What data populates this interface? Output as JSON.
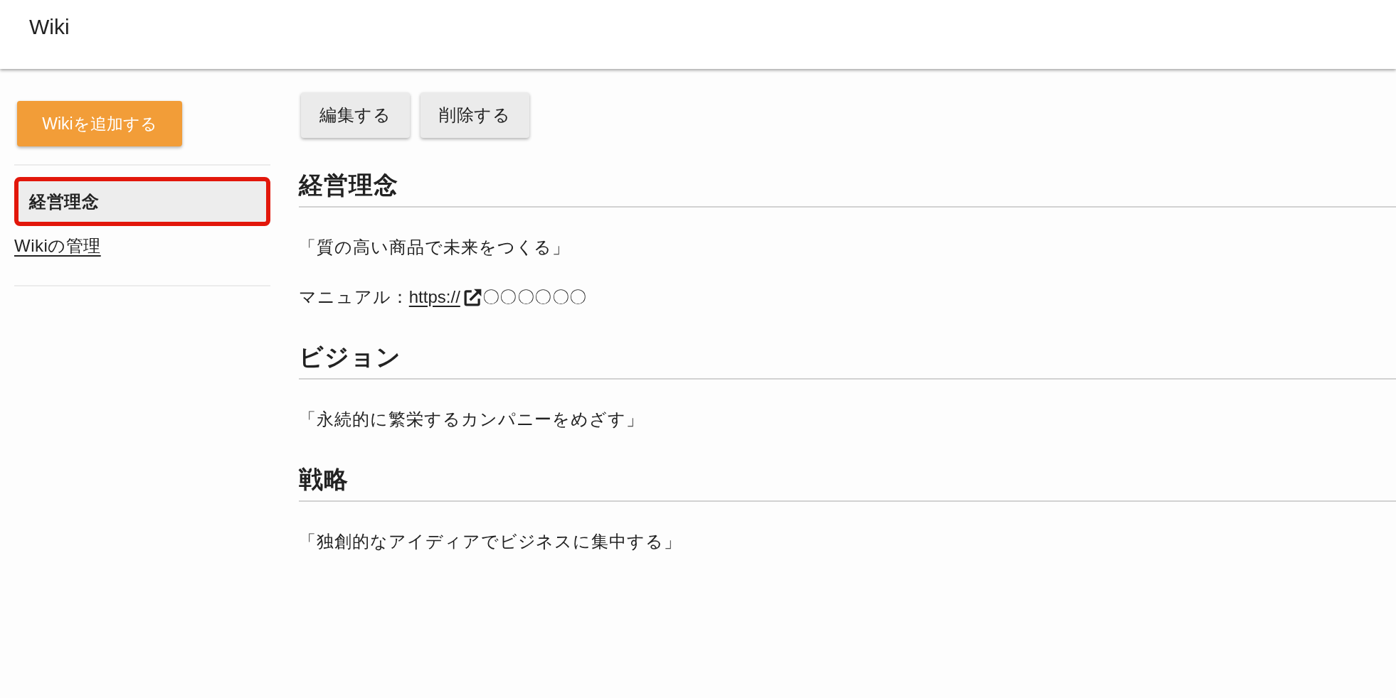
{
  "header": {
    "title": "Wiki"
  },
  "sidebar": {
    "add_button": "Wikiを追加する",
    "items": [
      {
        "label": "経営理念",
        "selected": true
      }
    ],
    "manage_link": "Wikiの管理"
  },
  "actions": [
    "編集する",
    "削除する"
  ],
  "sections": [
    {
      "heading": "経営理念",
      "paragraphs": [
        {
          "kind": "text",
          "text": "「質の高い商品で未来をつくる」"
        },
        {
          "kind": "link",
          "label": "マニュアル：",
          "link": "https://",
          "after": "〇〇〇〇〇〇"
        }
      ]
    },
    {
      "heading": "ビジョン",
      "paragraphs": [
        {
          "kind": "text",
          "text": "「永続的に繁栄するカンパニーをめざす」"
        }
      ]
    },
    {
      "heading": "戦略",
      "paragraphs": [
        {
          "kind": "text",
          "text": "「独創的なアイディアでビジネスに集中する」"
        }
      ]
    }
  ]
}
